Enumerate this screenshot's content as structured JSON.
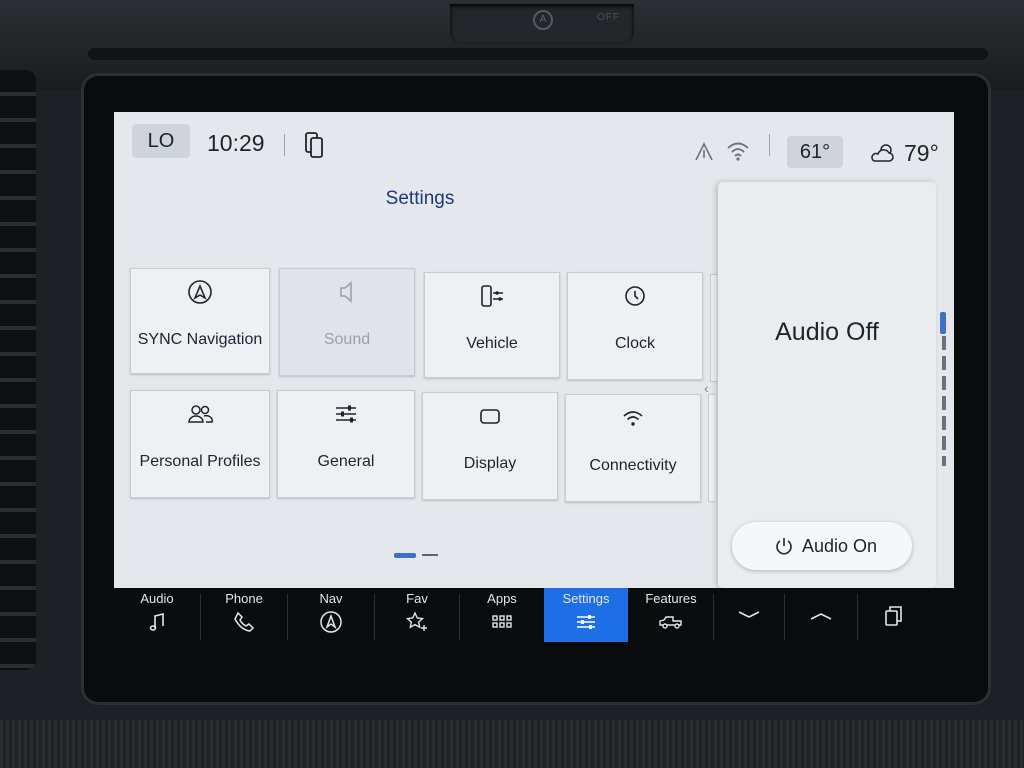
{
  "dashboard": {
    "top_control_off_label": "OFF"
  },
  "status_bar": {
    "climate_mode": "LO",
    "time": "10:29",
    "cabin_temperature": "61°",
    "outside_temperature": "79°",
    "icons": [
      "phone-projection-icon",
      "navigation-arrow-icon",
      "wifi-icon",
      "partly-cloudy-icon"
    ]
  },
  "settings": {
    "title": "Settings",
    "tiles": [
      {
        "label": "SYNC Navigation",
        "icon": "navigation-icon",
        "enabled": true
      },
      {
        "label": "Sound",
        "icon": "speaker-icon",
        "enabled": false
      },
      {
        "label": "Vehicle",
        "icon": "vehicle-settings-icon",
        "enabled": true
      },
      {
        "label": "Clock",
        "icon": "clock-icon",
        "enabled": true
      },
      {
        "label": "Personal Profiles",
        "icon": "profiles-icon",
        "enabled": true
      },
      {
        "label": "General",
        "icon": "sliders-icon",
        "enabled": true
      },
      {
        "label": "Display",
        "icon": "display-icon",
        "enabled": true
      },
      {
        "label": "Connectivity",
        "icon": "wifi-icon",
        "enabled": true
      }
    ],
    "page_indicator": {
      "current": 1,
      "total": 2
    }
  },
  "audio_panel": {
    "status": "Audio Off",
    "button_label": "Audio On"
  },
  "nav_bar": {
    "items": [
      {
        "label": "Audio",
        "icon": "music-note-icon",
        "active": false
      },
      {
        "label": "Phone",
        "icon": "phone-icon",
        "active": false
      },
      {
        "label": "Nav",
        "icon": "navigation-icon",
        "active": false
      },
      {
        "label": "Fav",
        "icon": "star-add-icon",
        "active": false
      },
      {
        "label": "Apps",
        "icon": "apps-grid-icon",
        "active": false
      },
      {
        "label": "Settings",
        "icon": "sliders-icon",
        "active": true
      },
      {
        "label": "Features",
        "icon": "truck-icon",
        "active": false
      }
    ],
    "extra_icons": [
      "chevron-down-icon",
      "chevron-up-icon",
      "multitask-icon"
    ],
    "active_color": "#1e6ee6"
  },
  "colors": {
    "screen_bg": "#e4e8ed",
    "title": "#1c3a7a",
    "accent": "#3f6fc6"
  }
}
